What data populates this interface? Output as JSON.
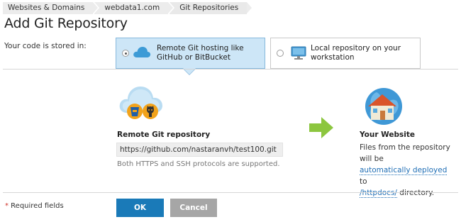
{
  "breadcrumbs": [
    "Websites & Domains",
    "webdata1.com",
    "Git Repositories"
  ],
  "page_title": "Add Git Repository",
  "stored_label": "Your code is stored in:",
  "options": {
    "remote": {
      "label": "Remote Git hosting like GitHub or BitBucket",
      "selected": true,
      "icon": "cloud-icon"
    },
    "local": {
      "label": "Local repository on your workstation",
      "selected": false,
      "icon": "monitor-icon"
    }
  },
  "remote_repo": {
    "label": "Remote Git repository",
    "value": "https://github.com/nastaranvh/test100.git",
    "hint": "Both HTTPS and SSH protocols are supported."
  },
  "website": {
    "title": "Your Website",
    "desc_prefix": "Files from the repository will be",
    "link_auto": "automatically deployed",
    "desc_to": "to",
    "link_dir": "/httpdocs/",
    "desc_suffix": " directory."
  },
  "required_star": "*",
  "required_text": " Required fields",
  "buttons": {
    "ok": "OK",
    "cancel": "Cancel"
  },
  "colors": {
    "accent": "#1a7ab8",
    "selected_bg": "#cde6f7",
    "arrow": "#8cc63f",
    "link": "#1f6eb5"
  }
}
